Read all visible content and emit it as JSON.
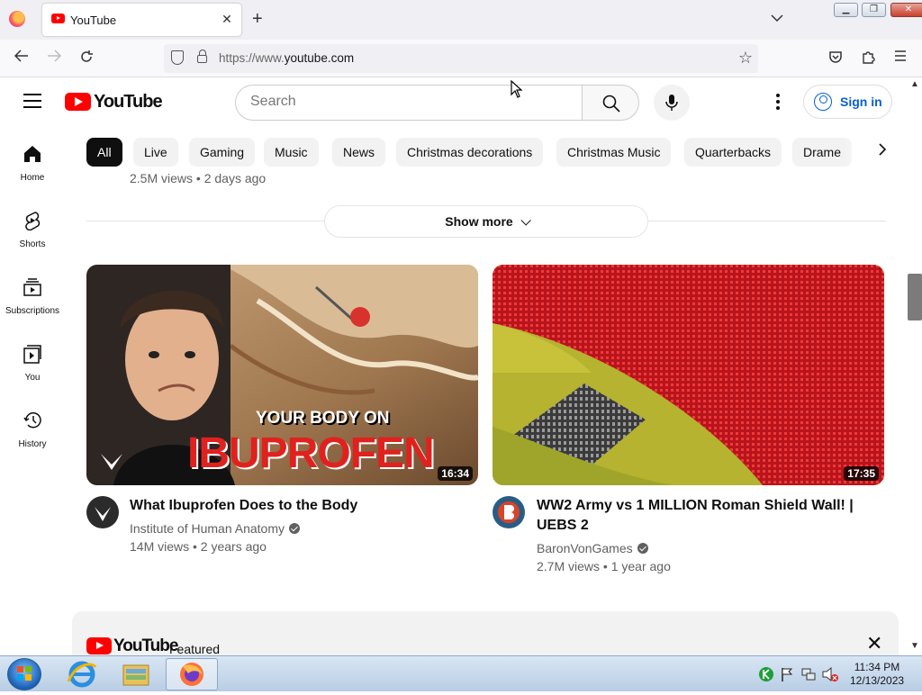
{
  "browser": {
    "tab_title": "YouTube",
    "tab_close": "✕",
    "new_tab": "+",
    "tab_list": "⌄",
    "url_scheme": "https://www.",
    "url_host": "youtube.com",
    "window_buttons": [
      "minimize",
      "restore",
      "close"
    ]
  },
  "header": {
    "logo_text": "YouTube",
    "search_placeholder": "Search",
    "signin_label": "Sign in"
  },
  "guide": {
    "items": [
      {
        "label": "Home",
        "icon": "home-icon"
      },
      {
        "label": "Shorts",
        "icon": "shorts-icon"
      },
      {
        "label": "Subscriptions",
        "icon": "subscriptions-icon"
      },
      {
        "label": "You",
        "icon": "you-icon"
      },
      {
        "label": "History",
        "icon": "history-icon"
      }
    ]
  },
  "chips": [
    "All",
    "Live",
    "Gaming",
    "Music",
    "News",
    "Christmas decorations",
    "Christmas Music",
    "Quarterbacks",
    "Drame"
  ],
  "chips_active": "All",
  "feed": {
    "prev_meta": "2.5M views • 2 days ago",
    "show_more": "Show more",
    "videos": [
      {
        "title": "What Ibuprofen Does to the Body",
        "channel": "Institute of Human Anatomy",
        "meta": "14M views • 2 years ago",
        "duration": "16:34",
        "thumb_line1": "YOUR BODY ON",
        "thumb_line2": "IBUPROFEN"
      },
      {
        "title": "WW2 Army vs 1 MILLION Roman Shield Wall! | UEBS 2",
        "channel": "BaronVonGames",
        "meta": "2.7M views • 1 year ago",
        "duration": "17:35"
      }
    ]
  },
  "featured": {
    "logo_text": "YouTube",
    "label": "Featured",
    "close": "✕"
  },
  "taskbar": {
    "time": "11:34 PM",
    "date": "12/13/2023"
  },
  "colors": {
    "brand_red": "#ff0000",
    "link_blue": "#065fd4",
    "chip_bg": "#f2f2f2"
  }
}
